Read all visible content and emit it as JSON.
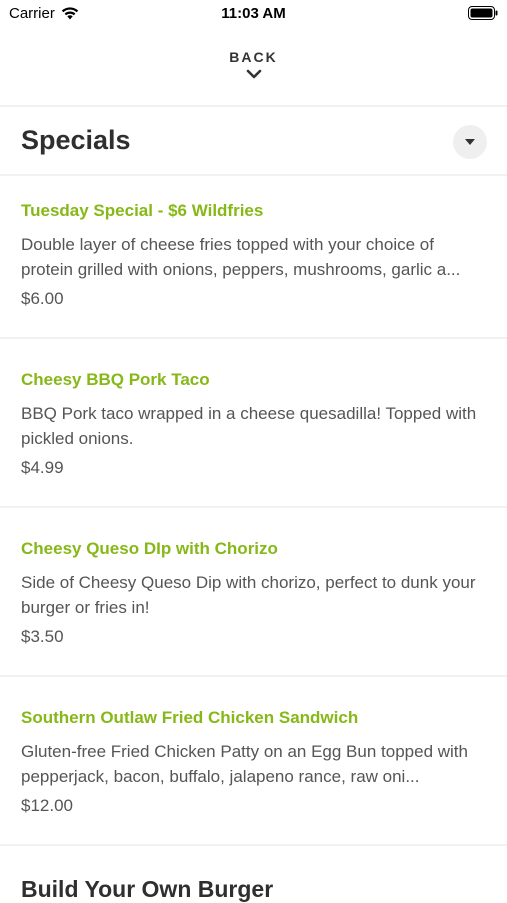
{
  "status": {
    "carrier": "Carrier",
    "time": "11:03 AM"
  },
  "nav": {
    "back_label": "BACK"
  },
  "section": {
    "title": "Specials"
  },
  "items": [
    {
      "name": "Tuesday Special - $6 Wildfries",
      "description": "Double layer of cheese fries topped with your choice of protein grilled with onions, peppers, mushrooms, garlic a...",
      "price": "$6.00"
    },
    {
      "name": "Cheesy BBQ Pork Taco",
      "description": "BBQ Pork taco wrapped in a cheese quesadilla! Topped with pickled onions.",
      "price": "$4.99"
    },
    {
      "name": "Cheesy Queso DIp with Chorizo",
      "description": "Side of  Cheesy Queso Dip with chorizo, perfect to dunk your burger or fries in!",
      "price": "$3.50"
    },
    {
      "name": "Southern Outlaw Fried Chicken Sandwich",
      "description": "Gluten-free Fried Chicken Patty on an Egg Bun topped with pepperjack, bacon, buffalo, jalapeno rance, raw oni...",
      "price": "$12.00"
    }
  ],
  "next_section": {
    "title": "Build Your Own Burger"
  },
  "colors": {
    "accent": "#86b817"
  },
  "icons": {
    "wifi": "wifi-icon",
    "battery": "battery-icon",
    "back": "chevron-down-icon",
    "dropdown": "triangle-down-icon"
  }
}
